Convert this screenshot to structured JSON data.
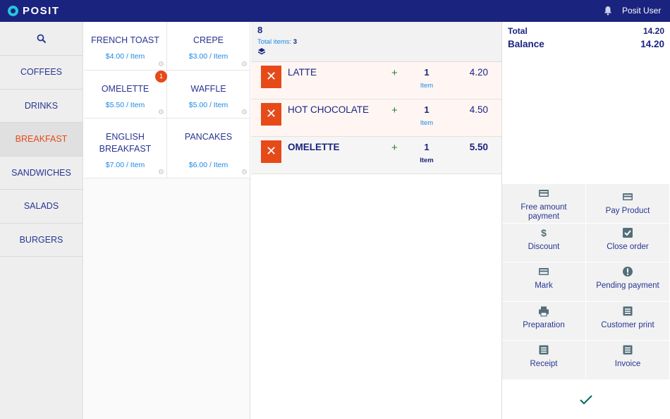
{
  "app": {
    "brand": "POSIT",
    "user_name": "Posit User"
  },
  "sidebar": {
    "categories": [
      {
        "label": "COFFEES",
        "active": false
      },
      {
        "label": "DRINKS",
        "active": false
      },
      {
        "label": "BREAKFAST",
        "active": true
      },
      {
        "label": "SANDWICHES",
        "active": false
      },
      {
        "label": "SALADS",
        "active": false
      },
      {
        "label": "BURGERS",
        "active": false
      }
    ]
  },
  "products": [
    {
      "name": "FRENCH TOAST",
      "price": "$4.00 / Item"
    },
    {
      "name": "CREPE",
      "price": "$3.00 / Item"
    },
    {
      "name": "OMELETTE",
      "price": "$5.50 / Item",
      "badge": "1"
    },
    {
      "name": "WAFFLE",
      "price": "$5.00 / Item"
    },
    {
      "name": "ENGLISH BREAKFAST",
      "price": "$7.00 / Item"
    },
    {
      "name": "PANCAKES",
      "price": "$6.00 / Item"
    }
  ],
  "order": {
    "number": "8",
    "total_items_label": "Total items:",
    "total_items_value": "3",
    "lines": [
      {
        "name": "LATTE",
        "qty": "1",
        "unit": "Item",
        "price": "4.20",
        "plus": "+",
        "delete": "✕"
      },
      {
        "name": "HOT CHOCOLATE",
        "qty": "1",
        "unit": "Item",
        "price": "4.50",
        "plus": "+",
        "delete": "✕"
      },
      {
        "name": "OMELETTE",
        "qty": "1",
        "unit": "Item",
        "price": "5.50",
        "plus": "+",
        "delete": "✕",
        "selected": true
      }
    ]
  },
  "summary": {
    "total_label": "Total",
    "total_value": "14.20",
    "balance_label": "Balance",
    "balance_value": "14.20"
  },
  "actions": [
    {
      "label": "Free amount payment",
      "icon": "card-icon"
    },
    {
      "label": "Pay Product",
      "icon": "card-icon"
    },
    {
      "label": "Discount",
      "icon": "dollar-icon"
    },
    {
      "label": "Close order",
      "icon": "checkbox-icon"
    },
    {
      "label": "Mark",
      "icon": "card-icon"
    },
    {
      "label": "Pending payment",
      "icon": "alert-icon"
    },
    {
      "label": "Preparation",
      "icon": "printer-icon"
    },
    {
      "label": "Customer print",
      "icon": "document-icon"
    },
    {
      "label": "Receipt",
      "icon": "document-icon"
    },
    {
      "label": "Invoice",
      "icon": "document-icon"
    }
  ],
  "colors": {
    "topbar": "#1a237e",
    "accent": "#e64a19",
    "text_primary": "#283593",
    "link": "#1e88e5",
    "plus_green": "#2e7d32",
    "confirm_teal": "#00695c"
  }
}
